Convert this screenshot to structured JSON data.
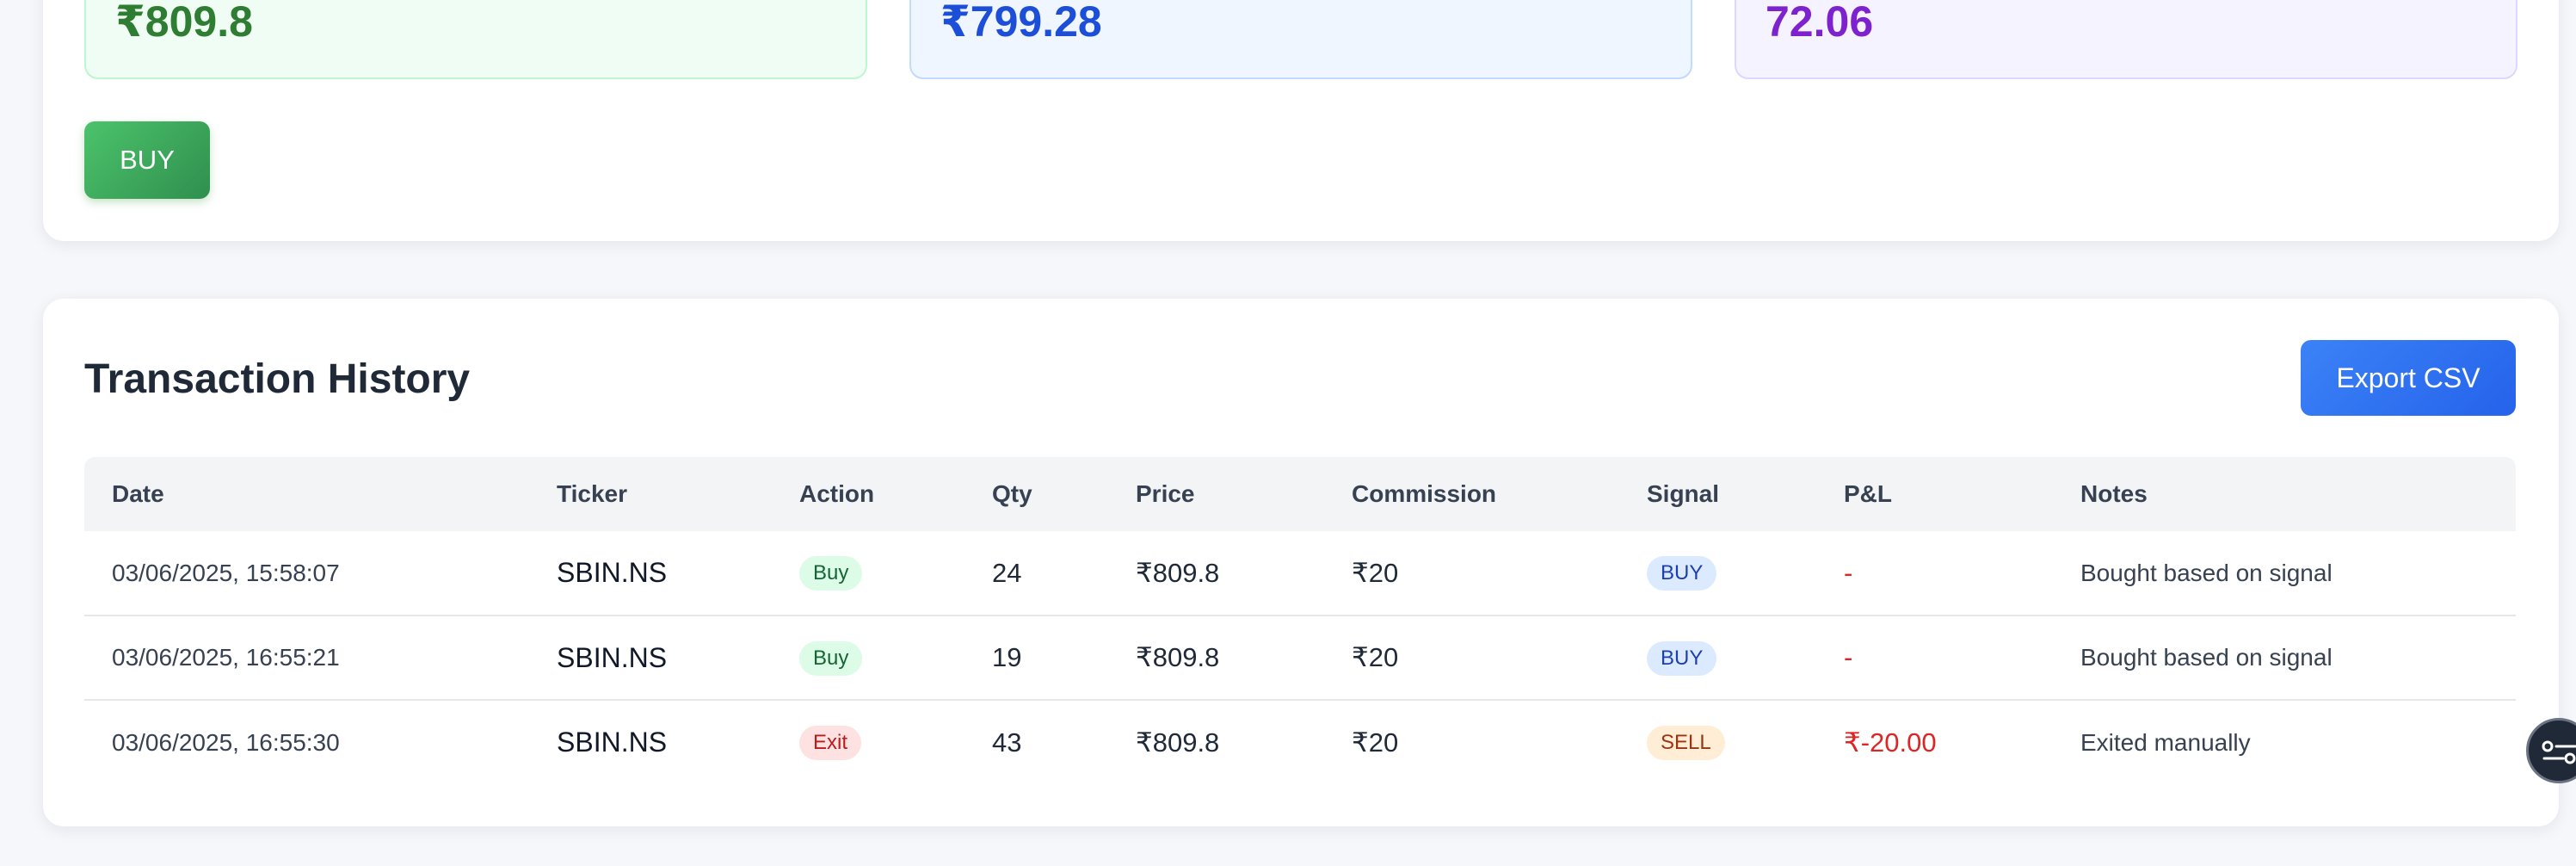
{
  "stats": [
    {
      "value": "₹809.8"
    },
    {
      "value": "₹799.28"
    },
    {
      "value": "72.06"
    }
  ],
  "actions": {
    "buy_label": "BUY"
  },
  "history": {
    "title": "Transaction History",
    "export_label": "Export CSV",
    "columns": [
      "Date",
      "Ticker",
      "Action",
      "Qty",
      "Price",
      "Commission",
      "Signal",
      "P&L",
      "Notes"
    ],
    "rows": [
      {
        "date": "03/06/2025, 15:58:07",
        "ticker": "SBIN.NS",
        "action": "Buy",
        "qty": "24",
        "price": "₹809.8",
        "commission": "₹20",
        "signal": "BUY",
        "pnl": "-",
        "notes": "Bought based on signal"
      },
      {
        "date": "03/06/2025, 16:55:21",
        "ticker": "SBIN.NS",
        "action": "Buy",
        "qty": "19",
        "price": "₹809.8",
        "commission": "₹20",
        "signal": "BUY",
        "pnl": "-",
        "notes": "Bought based on signal"
      },
      {
        "date": "03/06/2025, 16:55:30",
        "ticker": "SBIN.NS",
        "action": "Exit",
        "qty": "43",
        "price": "₹809.8",
        "commission": "₹20",
        "signal": "SELL",
        "pnl": "₹-20.00",
        "notes": "Exited manually"
      }
    ]
  },
  "colors": {
    "green": "#2e7d32",
    "blue": "#1d4ed8",
    "purple": "#7e22ce",
    "loss": "#dc2626"
  },
  "floating_button": {
    "icon": "list-settings-icon"
  }
}
